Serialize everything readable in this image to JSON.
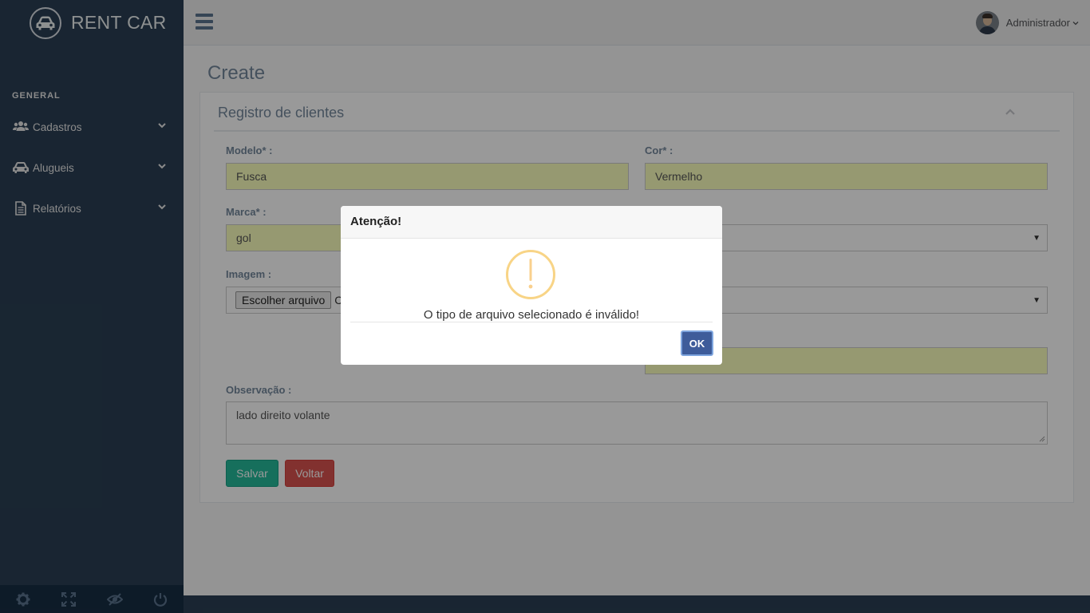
{
  "sidebar": {
    "brand": "RENT CAR",
    "section_label": "GENERAL",
    "items": [
      {
        "label": "Cadastros",
        "icon": "users-icon"
      },
      {
        "label": "Alugueis",
        "icon": "car-icon"
      },
      {
        "label": "Relatórios",
        "icon": "file-text-icon"
      }
    ],
    "footer_icons": [
      "gear-icon",
      "fullscreen-icon",
      "eye-slash-icon",
      "power-icon"
    ]
  },
  "topnav": {
    "user_name": "Administrador"
  },
  "page": {
    "title": "Create",
    "panel_title": "Registro de clientes"
  },
  "form": {
    "modelo": {
      "label": "Modelo* :",
      "value": "Fusca"
    },
    "cor": {
      "label": "Cor* :",
      "value": "Vermelho"
    },
    "marca": {
      "label": "Marca* :",
      "value": "gol"
    },
    "imagem": {
      "label": "Imagem :",
      "button": "Escolher arquivo",
      "status": "C"
    },
    "observacao": {
      "label": "Observação :",
      "value": "lado direito volante"
    },
    "save_label": "Salvar",
    "back_label": "Voltar"
  },
  "modal": {
    "title": "Atenção!",
    "message": "O tipo de arquivo selecionado é inválido!",
    "ok_label": "OK",
    "icon": "warning-icon"
  },
  "colors": {
    "sidebar": "#2a3f54",
    "autofill": "#faffbd",
    "success": "#26b99a",
    "danger": "#d9534f",
    "warning": "#f8d486",
    "ok_button": "#3e5c9a"
  }
}
